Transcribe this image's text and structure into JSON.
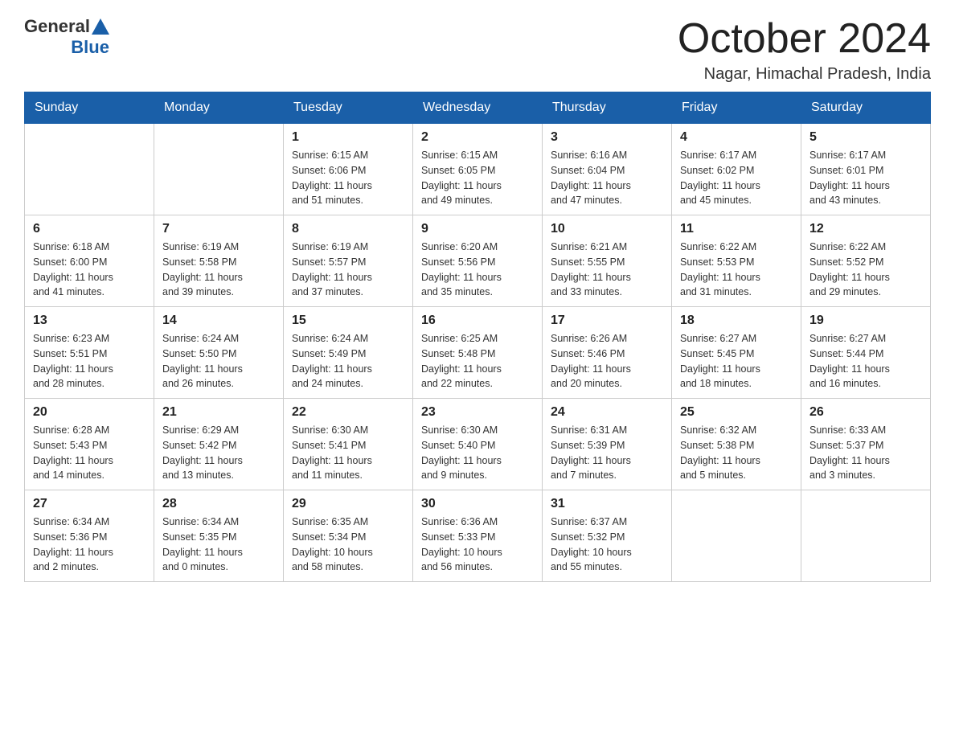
{
  "header": {
    "logo": {
      "general": "General",
      "blue": "Blue"
    },
    "title": "October 2024",
    "location": "Nagar, Himachal Pradesh, India"
  },
  "columns": [
    "Sunday",
    "Monday",
    "Tuesday",
    "Wednesday",
    "Thursday",
    "Friday",
    "Saturday"
  ],
  "weeks": [
    [
      {
        "day": "",
        "info": ""
      },
      {
        "day": "",
        "info": ""
      },
      {
        "day": "1",
        "info": "Sunrise: 6:15 AM\nSunset: 6:06 PM\nDaylight: 11 hours\nand 51 minutes."
      },
      {
        "day": "2",
        "info": "Sunrise: 6:15 AM\nSunset: 6:05 PM\nDaylight: 11 hours\nand 49 minutes."
      },
      {
        "day": "3",
        "info": "Sunrise: 6:16 AM\nSunset: 6:04 PM\nDaylight: 11 hours\nand 47 minutes."
      },
      {
        "day": "4",
        "info": "Sunrise: 6:17 AM\nSunset: 6:02 PM\nDaylight: 11 hours\nand 45 minutes."
      },
      {
        "day": "5",
        "info": "Sunrise: 6:17 AM\nSunset: 6:01 PM\nDaylight: 11 hours\nand 43 minutes."
      }
    ],
    [
      {
        "day": "6",
        "info": "Sunrise: 6:18 AM\nSunset: 6:00 PM\nDaylight: 11 hours\nand 41 minutes."
      },
      {
        "day": "7",
        "info": "Sunrise: 6:19 AM\nSunset: 5:58 PM\nDaylight: 11 hours\nand 39 minutes."
      },
      {
        "day": "8",
        "info": "Sunrise: 6:19 AM\nSunset: 5:57 PM\nDaylight: 11 hours\nand 37 minutes."
      },
      {
        "day": "9",
        "info": "Sunrise: 6:20 AM\nSunset: 5:56 PM\nDaylight: 11 hours\nand 35 minutes."
      },
      {
        "day": "10",
        "info": "Sunrise: 6:21 AM\nSunset: 5:55 PM\nDaylight: 11 hours\nand 33 minutes."
      },
      {
        "day": "11",
        "info": "Sunrise: 6:22 AM\nSunset: 5:53 PM\nDaylight: 11 hours\nand 31 minutes."
      },
      {
        "day": "12",
        "info": "Sunrise: 6:22 AM\nSunset: 5:52 PM\nDaylight: 11 hours\nand 29 minutes."
      }
    ],
    [
      {
        "day": "13",
        "info": "Sunrise: 6:23 AM\nSunset: 5:51 PM\nDaylight: 11 hours\nand 28 minutes."
      },
      {
        "day": "14",
        "info": "Sunrise: 6:24 AM\nSunset: 5:50 PM\nDaylight: 11 hours\nand 26 minutes."
      },
      {
        "day": "15",
        "info": "Sunrise: 6:24 AM\nSunset: 5:49 PM\nDaylight: 11 hours\nand 24 minutes."
      },
      {
        "day": "16",
        "info": "Sunrise: 6:25 AM\nSunset: 5:48 PM\nDaylight: 11 hours\nand 22 minutes."
      },
      {
        "day": "17",
        "info": "Sunrise: 6:26 AM\nSunset: 5:46 PM\nDaylight: 11 hours\nand 20 minutes."
      },
      {
        "day": "18",
        "info": "Sunrise: 6:27 AM\nSunset: 5:45 PM\nDaylight: 11 hours\nand 18 minutes."
      },
      {
        "day": "19",
        "info": "Sunrise: 6:27 AM\nSunset: 5:44 PM\nDaylight: 11 hours\nand 16 minutes."
      }
    ],
    [
      {
        "day": "20",
        "info": "Sunrise: 6:28 AM\nSunset: 5:43 PM\nDaylight: 11 hours\nand 14 minutes."
      },
      {
        "day": "21",
        "info": "Sunrise: 6:29 AM\nSunset: 5:42 PM\nDaylight: 11 hours\nand 13 minutes."
      },
      {
        "day": "22",
        "info": "Sunrise: 6:30 AM\nSunset: 5:41 PM\nDaylight: 11 hours\nand 11 minutes."
      },
      {
        "day": "23",
        "info": "Sunrise: 6:30 AM\nSunset: 5:40 PM\nDaylight: 11 hours\nand 9 minutes."
      },
      {
        "day": "24",
        "info": "Sunrise: 6:31 AM\nSunset: 5:39 PM\nDaylight: 11 hours\nand 7 minutes."
      },
      {
        "day": "25",
        "info": "Sunrise: 6:32 AM\nSunset: 5:38 PM\nDaylight: 11 hours\nand 5 minutes."
      },
      {
        "day": "26",
        "info": "Sunrise: 6:33 AM\nSunset: 5:37 PM\nDaylight: 11 hours\nand 3 minutes."
      }
    ],
    [
      {
        "day": "27",
        "info": "Sunrise: 6:34 AM\nSunset: 5:36 PM\nDaylight: 11 hours\nand 2 minutes."
      },
      {
        "day": "28",
        "info": "Sunrise: 6:34 AM\nSunset: 5:35 PM\nDaylight: 11 hours\nand 0 minutes."
      },
      {
        "day": "29",
        "info": "Sunrise: 6:35 AM\nSunset: 5:34 PM\nDaylight: 10 hours\nand 58 minutes."
      },
      {
        "day": "30",
        "info": "Sunrise: 6:36 AM\nSunset: 5:33 PM\nDaylight: 10 hours\nand 56 minutes."
      },
      {
        "day": "31",
        "info": "Sunrise: 6:37 AM\nSunset: 5:32 PM\nDaylight: 10 hours\nand 55 minutes."
      },
      {
        "day": "",
        "info": ""
      },
      {
        "day": "",
        "info": ""
      }
    ]
  ]
}
